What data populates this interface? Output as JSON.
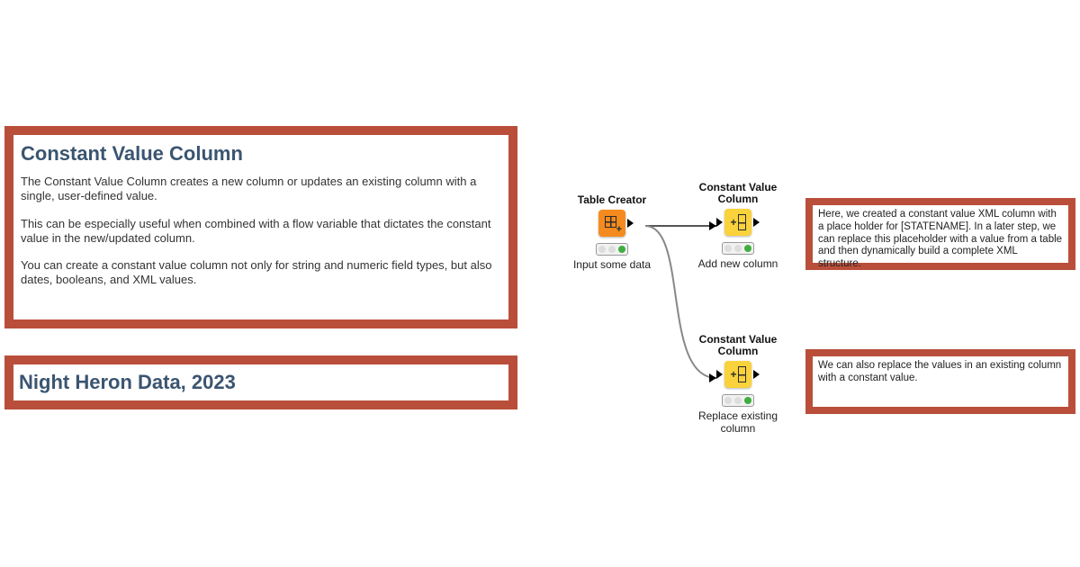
{
  "intro_box": {
    "heading": "Constant Value Column",
    "p1": "The Constant Value Column creates a new column or updates an existing column with a single, user-defined value.",
    "p2": "This can be especially useful when combined with a flow variable that dictates the constant value in the new/updated column.",
    "p3": "You can create a constant value column not only for string and numeric field types, but also dates, booleans, and XML values."
  },
  "credit": "Night Heron Data, 2023",
  "nodes": {
    "table_creator": {
      "title": "Table Creator",
      "caption": "Input some data"
    },
    "cvc_add": {
      "title": "Constant Value Column",
      "caption": "Add new column"
    },
    "cvc_replace": {
      "title": "Constant Value Column",
      "caption": "Replace existing column"
    }
  },
  "annotation1": "Here, we created a constant value XML column with a place holder for [STATENAME]. In a later step, we can replace this placeholder with a value from a table and then dynamically build a complete XML structure.",
  "annotation2": "We can also replace the values in an existing column with a constant value."
}
